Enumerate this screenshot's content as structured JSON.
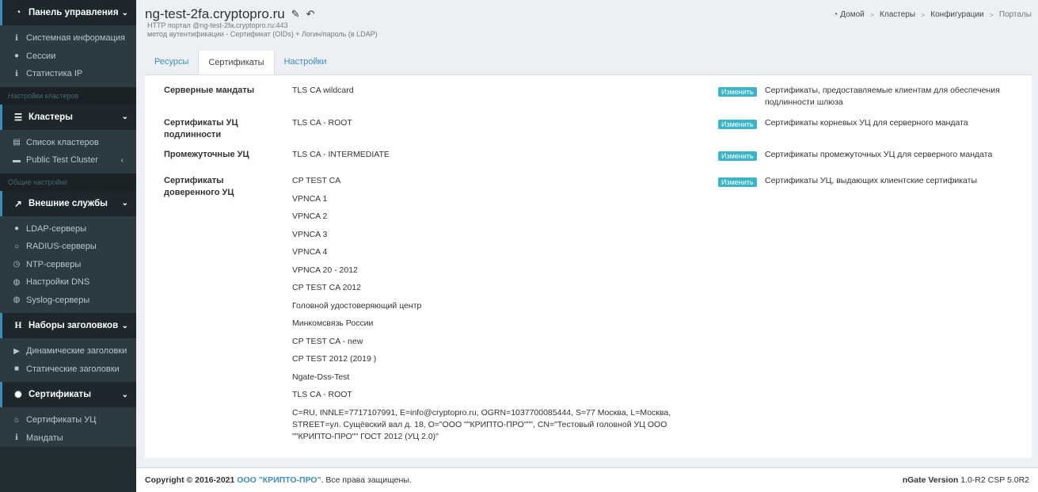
{
  "sidebar": {
    "group1": {
      "label": "Панель управления",
      "icon": "dashboard-icon"
    },
    "items1": [
      {
        "label": "Системная информация",
        "icon": "info-icon"
      },
      {
        "label": "Сессии",
        "icon": "user-icon"
      },
      {
        "label": "Статистика IP",
        "icon": "info-icon"
      }
    ],
    "header1": "Настройки кластеров",
    "group2": {
      "label": "Кластеры",
      "icon": "database-icon"
    },
    "items2": [
      {
        "label": "Список кластеров",
        "icon": "list-icon"
      },
      {
        "label": "Public Test Cluster",
        "icon": "server-icon"
      }
    ],
    "header2": "Общие настройки",
    "group3": {
      "label": "Внешние службы",
      "icon": "external-link-icon"
    },
    "items3": [
      {
        "label": "LDAP-серверы",
        "icon": "users-icon"
      },
      {
        "label": "RADIUS-серверы",
        "icon": "circle-notch-icon"
      },
      {
        "label": "NTP-серверы",
        "icon": "clock-icon"
      },
      {
        "label": "Настройки DNS",
        "icon": "globe-icon"
      },
      {
        "label": "Syslog-серверы",
        "icon": "globe-icon"
      }
    ],
    "group4": {
      "label": "Наборы заголовков",
      "icon": "header-icon"
    },
    "items4": [
      {
        "label": "Динамические заголовки",
        "icon": "play-icon"
      },
      {
        "label": "Статические заголовки",
        "icon": "stop-icon"
      }
    ],
    "group5": {
      "label": "Сертификаты",
      "icon": "certificate-icon"
    },
    "items5": [
      {
        "label": "Сертификаты УЦ",
        "icon": "institution-icon"
      },
      {
        "label": "Мандаты",
        "icon": "info-icon"
      }
    ]
  },
  "header": {
    "title": "ng-test-2fa.cryptopro.ru",
    "subtitle_line1": "HTTP портал @ng-test-2fa.cryptopro.ru:443",
    "subtitle_line2": "метод аутентификации - Сертификат (OIDs) + Логин/пароль (в LDAP)"
  },
  "breadcrumb": [
    "Домой",
    "Кластеры",
    "Конфигурации",
    "Порталы"
  ],
  "tabs": [
    "Ресурсы",
    "Сертификаты",
    "Настройки"
  ],
  "active_tab": "Сертификаты",
  "edit_label": "Изменить",
  "rows": [
    {
      "label": "Серверные мандаты",
      "values": [
        "TLS CA wildcard"
      ],
      "description": "Сертификаты, предоставляемые клиентам для обеспечения подлинности шлюза"
    },
    {
      "label": "Сертификаты УЦ подлинности",
      "values": [
        "TLS CA - ROOT"
      ],
      "description": "Сертификаты корневых УЦ для серверного мандата"
    },
    {
      "label": "Промежуточные УЦ",
      "values": [
        "TLS CA - INTERMEDIATE"
      ],
      "description": "Сертификаты промежуточных УЦ для серверного мандата"
    },
    {
      "label": "Сертификаты доверенного УЦ",
      "values": [
        "CP TEST CA",
        "VPNCA 1",
        "VPNCA 2",
        "VPNCA 3",
        "VPNCA 4",
        "VPNCA 20 - 2012",
        "CP TEST CA 2012",
        "Головной удостоверяющий центр",
        "Минкомсвязь России",
        "CP TEST CA - new",
        "CP TEST 2012 (2019 )",
        "Ngate-Dss-Test",
        "TLS CA - ROOT",
        "C=RU, INNLE=7717107991, E=info@cryptopro.ru, OGRN=1037700085444, S=77 Москва, L=Москва, STREET=ул. Сущёвский вал д. 18, O=\"ООО \"\"КРИПТО-ПРО\"\"\", CN=\"Тестовый головной УЦ ООО \"\"КРИПТО-ПРО\"\" ГОСТ 2012 (УЦ 2.0)\""
      ],
      "description": "Сертификаты УЦ, выдающих клиентские сертификаты"
    }
  ],
  "footer": {
    "copyright": "Copyright © 2016-2021",
    "company": "ООО \"КРИПТО-ПРО\"",
    "rights": ". Все права защищены.",
    "version_label": "nGate Version",
    "version": "1.0-R2 CSP 5.0R2"
  }
}
